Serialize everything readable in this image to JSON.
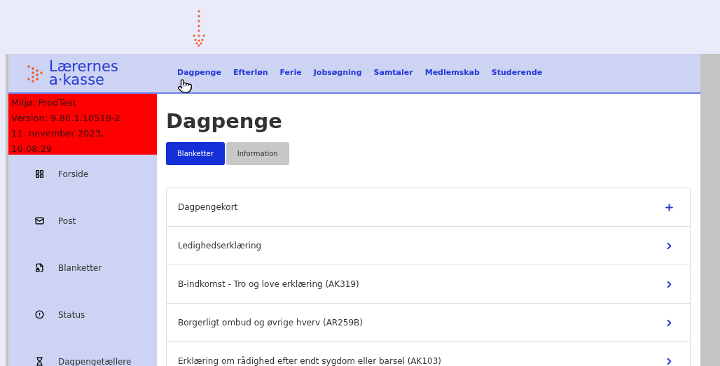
{
  "logo": {
    "line_1": "Lærernes",
    "line_2": "a·kasse"
  },
  "nav": [
    {
      "label": "Dagpenge"
    },
    {
      "label": "Efterløn"
    },
    {
      "label": "Ferie"
    },
    {
      "label": "Jobsøgning"
    },
    {
      "label": "Samtaler"
    },
    {
      "label": "Medlemskab"
    },
    {
      "label": "Studerende"
    }
  ],
  "environment_banner": [
    "Miljø: ProdTest",
    "Version: 9.86.1.10519-2",
    "11. november 2023,",
    "16:08:29"
  ],
  "sidebar": {
    "items": [
      {
        "label": "Forside"
      },
      {
        "label": "Post"
      },
      {
        "label": "Blanketter"
      },
      {
        "label": "Status"
      },
      {
        "label": "Dagpengetællere"
      }
    ]
  },
  "page_title": "Dagpenge",
  "tabs": [
    {
      "label": "Blanketter",
      "selected": true
    },
    {
      "label": "Information",
      "selected": false
    }
  ],
  "forms": [
    {
      "label": "Dagpengekort",
      "kind": "expand"
    },
    {
      "label": "Ledighedserklæring",
      "kind": "link"
    },
    {
      "label": "B-indkomst - Tro og love erklæring (AK319)",
      "kind": "link"
    },
    {
      "label": "Borgerligt ombud og øvrige hverv (AR259B)",
      "kind": "link"
    },
    {
      "label": "Erklæring om rådighed efter endt sygdom eller barsel (AK103)",
      "kind": "link"
    }
  ]
}
